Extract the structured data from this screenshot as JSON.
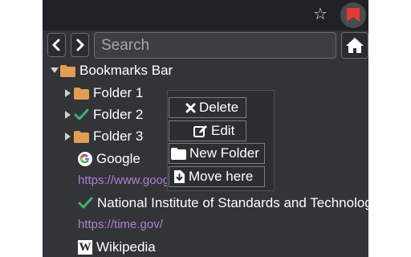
{
  "search": {
    "placeholder": "Search"
  },
  "tree": {
    "root_label": "Bookmarks Bar",
    "folders": [
      {
        "label": "Folder 1"
      },
      {
        "label": "Folder 2"
      },
      {
        "label": "Folder 3"
      }
    ],
    "bookmarks": [
      {
        "title": "Google",
        "url": "https://www.google.com/"
      },
      {
        "title": "National Institute of Standards and Technology",
        "url": "https://time.gov/"
      },
      {
        "title": "Wikipedia"
      }
    ]
  },
  "context_menu": {
    "delete": "Delete",
    "edit": "Edit",
    "new_folder": "New Folder",
    "move_here": "Move here"
  },
  "colors": {
    "panel_bg": "#333437",
    "folder": "#e39d53",
    "check": "#3cb371",
    "url": "#b47dd7",
    "extension_flag": "#e53935"
  }
}
